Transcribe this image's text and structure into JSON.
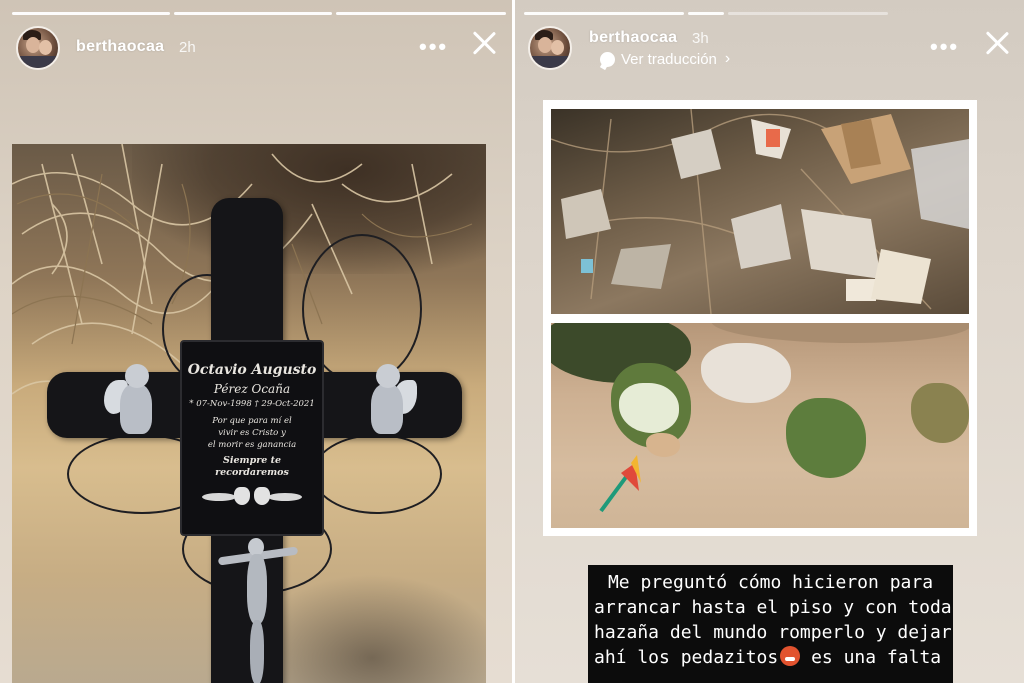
{
  "stories": [
    {
      "id": "left",
      "username": "berthaocaa",
      "time": "2h",
      "progress": {
        "segments": 3,
        "completed": 3
      },
      "plaque": {
        "name": "Octavio Augusto",
        "surname": "Pérez Ocaña",
        "dates": "* 07-Nov-1998 † 29-Oct-2021",
        "verse_lines": [
          "Por que para mí el",
          "vivir es Cristo y",
          "el morir es ganancia"
        ],
        "motto": "Siempre te recordaremos"
      }
    },
    {
      "id": "right",
      "username": "berthaocaa",
      "time": "3h",
      "progress": {
        "segments": 3,
        "completed": 2
      },
      "translate_label": "Ver traducción",
      "caption_lines": [
        "Me preguntó cómo hicieron para",
        "arrancar hasta el piso y con toda la",
        "hazaña del mundo romperlo y dejar",
        "ahí los pedazitos",
        "es una falta de"
      ]
    }
  ],
  "icons": {
    "more": "more-horizontal-icon",
    "close": "close-icon",
    "translate": "speech-bubble-icon",
    "chevron": "chevron-right-icon",
    "emoji": "angry-face-emoji-icon"
  },
  "colors": {
    "caption_bg": "#0c0c0c",
    "caption_text": "#ffffff",
    "header_text": "#ffffff"
  }
}
